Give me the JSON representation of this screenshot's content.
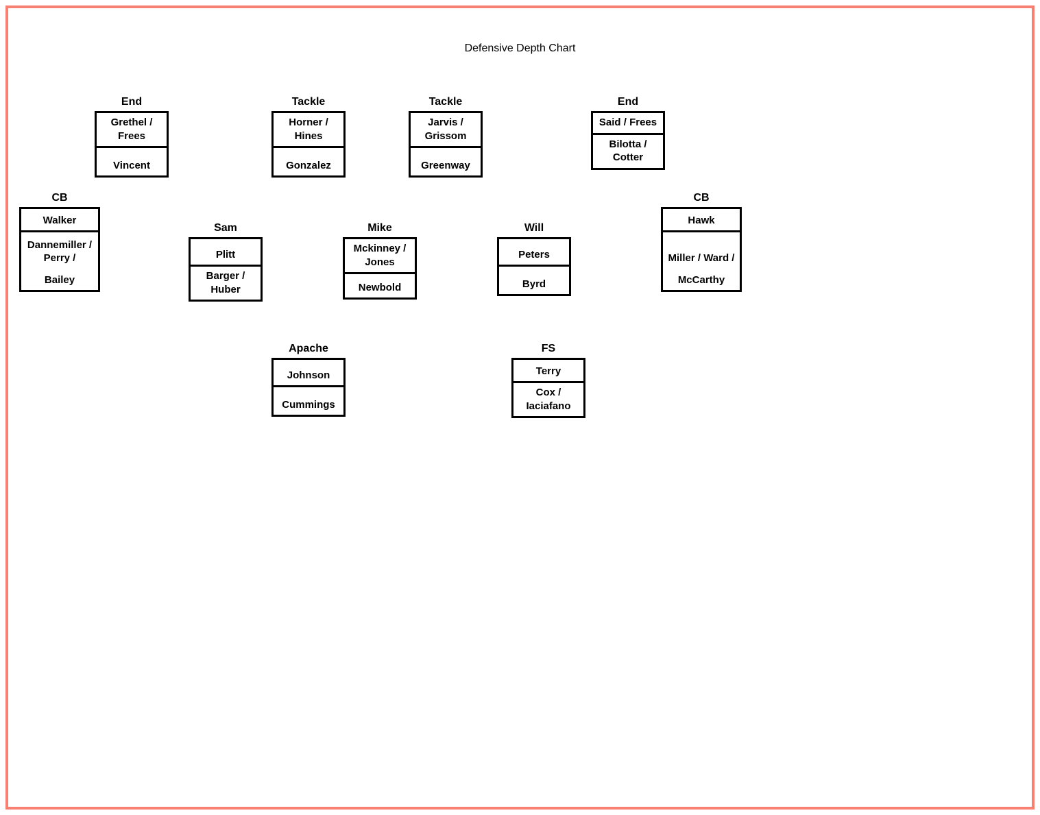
{
  "title": "Defensive Depth Chart",
  "positions": {
    "end_left": {
      "label": "End",
      "depth": [
        "Grethel / Frees",
        "Vincent"
      ]
    },
    "tackle_left": {
      "label": "Tackle",
      "depth": [
        "Horner / Hines",
        "Gonzalez"
      ]
    },
    "tackle_right": {
      "label": "Tackle",
      "depth": [
        "Jarvis / Grissom",
        "Greenway"
      ]
    },
    "end_right": {
      "label": "End",
      "depth": [
        "Said / Frees",
        "Bilotta / Cotter"
      ]
    },
    "cb_left": {
      "label": "CB",
      "depth": [
        "Walker",
        "Dannemiller / Perry /",
        "Bailey"
      ]
    },
    "sam": {
      "label": "Sam",
      "depth": [
        "Plitt",
        "Barger / Huber"
      ]
    },
    "mike": {
      "label": "Mike",
      "depth": [
        "Mckinney / Jones",
        "Newbold"
      ]
    },
    "will": {
      "label": "Will",
      "depth": [
        "Peters",
        "Byrd"
      ]
    },
    "cb_right": {
      "label": "CB",
      "depth": [
        "Hawk",
        "Miller / Ward /",
        "McCarthy"
      ]
    },
    "apache": {
      "label": "Apache",
      "depth": [
        "Johnson",
        "Cummings"
      ]
    },
    "fs": {
      "label": "FS",
      "depth": [
        "Terry",
        "Cox / Iaciafano"
      ]
    }
  }
}
